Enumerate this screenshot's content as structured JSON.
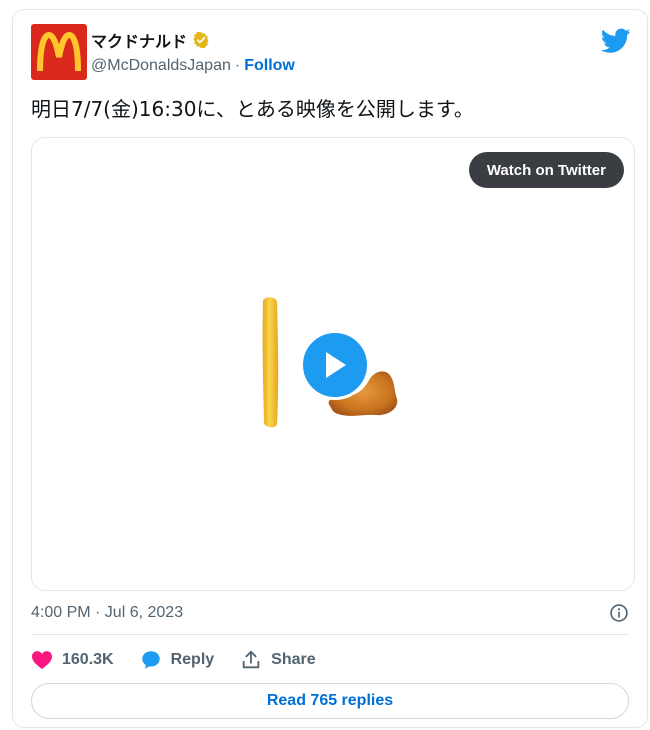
{
  "author": {
    "display_name": "マクドナルド",
    "handle": "@McDonaldsJapan",
    "separator": "·",
    "follow_label": "Follow",
    "avatar_bg": "#da291c",
    "logo_color": "#ffc72c"
  },
  "tweet": {
    "text": "明日7/7(金)16:30に、とある映像を公開します。"
  },
  "media": {
    "watch_label": "Watch on Twitter"
  },
  "meta": {
    "timestamp": "4:00 PM · Jul 6, 2023"
  },
  "actions": {
    "likes": "160.3K",
    "reply_label": "Reply",
    "share_label": "Share"
  },
  "read_replies_label": "Read 765 replies",
  "colors": {
    "twitter_blue": "#1d9bf0",
    "link_blue": "#006fd6",
    "heart_pink": "#f91880",
    "verified_gold": "#e2b719"
  },
  "icons": [
    "mcdonalds-logo-icon",
    "verified-badge-icon",
    "twitter-bird-icon",
    "play-icon",
    "info-icon",
    "heart-icon",
    "reply-bubble-icon",
    "share-icon"
  ]
}
